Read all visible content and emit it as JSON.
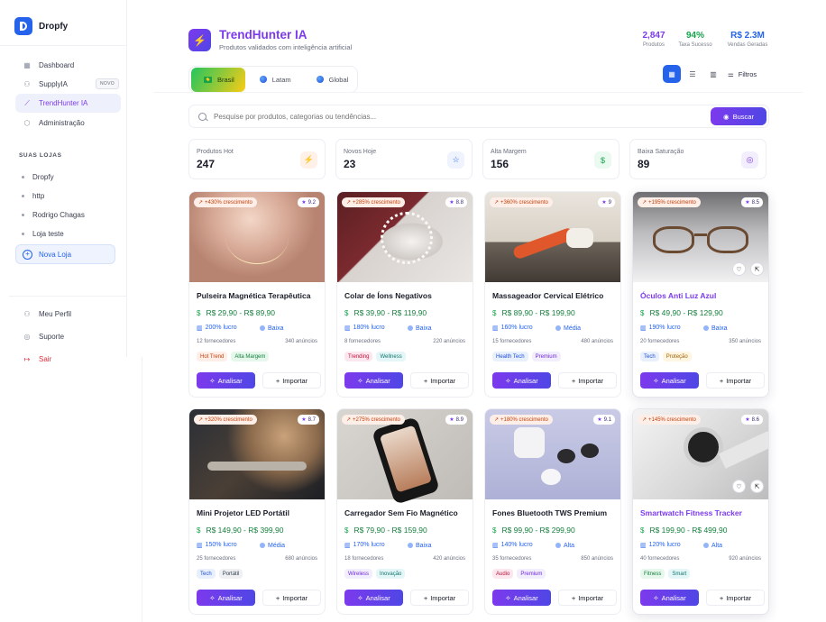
{
  "brand": {
    "name": "Dropfy"
  },
  "sidebar": {
    "nav": [
      {
        "label": "Dashboard",
        "icon": "grid-icon"
      },
      {
        "label": "SupplyIA",
        "icon": "users-icon",
        "badge": "NOVO"
      },
      {
        "label": "TrendHunter IA",
        "icon": "trend-icon",
        "active": true
      },
      {
        "label": "Administração",
        "icon": "shield-icon"
      }
    ],
    "stores_title": "SUAS LOJAS",
    "stores": [
      "Dropfy",
      "http",
      "Rodrigo Chagas",
      "Loja teste"
    ],
    "new_store": "Nova Loja",
    "bottom": [
      {
        "label": "Meu Perfil",
        "icon": "user-icon"
      },
      {
        "label": "Suporte",
        "icon": "support-icon"
      },
      {
        "label": "Sair",
        "icon": "logout-icon",
        "danger": true
      }
    ]
  },
  "header": {
    "title": "TrendHunter IA",
    "subtitle": "Produtos validados com inteligência artificial",
    "stats": [
      {
        "value": "2,847",
        "label": "Produtos",
        "color": "#7c3aed"
      },
      {
        "value": "94%",
        "label": "Taxa Sucesso",
        "color": "#16a34a"
      },
      {
        "value": "R$ 2.3M",
        "label": "Vendas Geradas",
        "color": "#2563eb"
      }
    ]
  },
  "tabs": [
    {
      "label": "Brasil",
      "active": true
    },
    {
      "label": "Latam"
    },
    {
      "label": "Global"
    }
  ],
  "filters_label": "Filtros",
  "search": {
    "placeholder": "Pesquise por produtos, categorias ou tendências...",
    "button": "Buscar"
  },
  "kpis": [
    {
      "label": "Produtos Hot",
      "value": "247",
      "icon": "⚡",
      "icon_color": "#ea580c",
      "icon_bg": "#fff1e8"
    },
    {
      "label": "Novos Hoje",
      "value": "23",
      "icon": "☆",
      "icon_color": "#2563eb",
      "icon_bg": "#eef3fd"
    },
    {
      "label": "Alta Margem",
      "value": "156",
      "icon": "$",
      "icon_color": "#16a34a",
      "icon_bg": "#eafaf0"
    },
    {
      "label": "Baixa Saturação",
      "value": "89",
      "icon": "◎",
      "icon_color": "#7c3aed",
      "icon_bg": "#f3eefe"
    }
  ],
  "card_actions": {
    "analyze": "Analisar",
    "import": "Importar"
  },
  "products": [
    {
      "growth": "+430% crescimento",
      "score": "9.2",
      "name": "Pulseira Magnética Terapêutica",
      "price": "R$ 29,90 - R$ 89,90",
      "profit": "200% lucro",
      "level": "Baixa",
      "suppliers": "12 fornecedores",
      "ads": "340 anúncios",
      "tags": [
        "Hot Trend",
        "Alta Margem"
      ],
      "image": "necklace-neck-image"
    },
    {
      "growth": "+285% crescimento",
      "score": "8.8",
      "name": "Colar de Íons Negativos",
      "price": "R$ 39,90 - R$ 119,90",
      "profit": "180% lucro",
      "level": "Baixa",
      "suppliers": "8 fornecedores",
      "ads": "220 anúncios",
      "tags": [
        "Trending",
        "Wellness"
      ],
      "image": "pearl-necklace-image"
    },
    {
      "growth": "+360% crescimento",
      "score": "9",
      "name": "Massageador Cervical Elétrico",
      "price": "R$ 89,90 - R$ 199,90",
      "profit": "160% lucro",
      "level": "Média",
      "suppliers": "15 fornecedores",
      "ads": "480 anúncios",
      "tags": [
        "Health Tech",
        "Premium"
      ],
      "image": "woman-exercise-image"
    },
    {
      "growth": "+195% crescimento",
      "score": "8.5",
      "name": "Óculos Anti Luz Azul",
      "price": "R$ 49,90 - R$ 129,90",
      "profit": "190% lucro",
      "level": "Baixa",
      "suppliers": "20 fornecedores",
      "ads": "350 anúncios",
      "tags": [
        "Tech",
        "Proteção"
      ],
      "image": "glasses-image",
      "highlight": true
    },
    {
      "growth": "+320% crescimento",
      "score": "8.7",
      "name": "Mini Projetor LED Portátil",
      "price": "R$ 149,90 - R$ 399,90",
      "profit": "150% lucro",
      "level": "Média",
      "suppliers": "25 fornecedores",
      "ads": "680 anúncios",
      "tags": [
        "Tech",
        "Portátil"
      ],
      "image": "camera-man-image"
    },
    {
      "growth": "+275% crescimento",
      "score": "8.9",
      "name": "Carregador Sem Fio Magnético",
      "price": "R$ 79,90 - R$ 159,90",
      "profit": "170% lucro",
      "level": "Baixa",
      "suppliers": "18 fornecedores",
      "ads": "420 anúncios",
      "tags": [
        "Wireless",
        "Inovação"
      ],
      "image": "smartphone-image"
    },
    {
      "growth": "+180% crescimento",
      "score": "9.1",
      "name": "Fones Bluetooth TWS Premium",
      "price": "R$ 99,90 - R$ 299,90",
      "profit": "140% lucro",
      "level": "Alta",
      "suppliers": "35 fornecedores",
      "ads": "850 anúncios",
      "tags": [
        "Audio",
        "Premium"
      ],
      "image": "earbuds-image"
    },
    {
      "growth": "+145% crescimento",
      "score": "8.6",
      "name": "Smartwatch Fitness Tracker",
      "price": "R$ 199,90 - R$ 499,90",
      "profit": "120% lucro",
      "level": "Alta",
      "suppliers": "40 fornecedores",
      "ads": "920 anúncios",
      "tags": [
        "Fitness",
        "Smart"
      ],
      "image": "smartwatch-image",
      "highlight": true
    }
  ],
  "tag_colors": {
    "Hot Trend": [
      "#fdeee7",
      "#c2410c"
    ],
    "Alta Margem": [
      "#e6f7ec",
      "#15803d"
    ],
    "Trending": [
      "#fde7ee",
      "#be123c"
    ],
    "Wellness": [
      "#e4f6f7",
      "#0f766e"
    ],
    "Health Tech": [
      "#e8f0fd",
      "#1d4ed8"
    ],
    "Premium": [
      "#f3eefe",
      "#6d28d9"
    ],
    "Tech": [
      "#e8f0fd",
      "#1d4ed8"
    ],
    "Proteção": [
      "#fef6e0",
      "#a16207"
    ],
    "Portátil": [
      "#eef0f4",
      "#374151"
    ],
    "Wireless": [
      "#f3eefe",
      "#6d28d9"
    ],
    "Inovação": [
      "#e4f6f7",
      "#0f766e"
    ],
    "Audio": [
      "#fde7ee",
      "#be123c"
    ],
    "Fitness": [
      "#e6f7ec",
      "#15803d"
    ],
    "Smart": [
      "#e4f6f7",
      "#0f766e"
    ]
  }
}
